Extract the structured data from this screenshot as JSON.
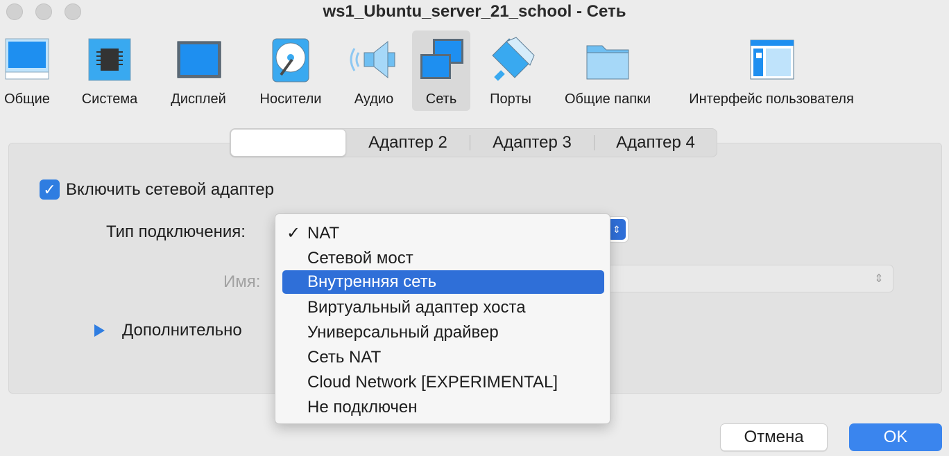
{
  "window": {
    "title": "ws1_Ubuntu_server_21_school - Сеть"
  },
  "toolbar": {
    "items": [
      {
        "label": "Общие",
        "icon": "general-monitor-icon"
      },
      {
        "label": "Система",
        "icon": "chip-icon"
      },
      {
        "label": "Дисплей",
        "icon": "display-icon"
      },
      {
        "label": "Носители",
        "icon": "storage-disk-icon"
      },
      {
        "label": "Аудио",
        "icon": "speaker-icon"
      },
      {
        "label": "Сеть",
        "icon": "network-icon"
      },
      {
        "label": "Порты",
        "icon": "ports-plug-icon"
      },
      {
        "label": "Общие папки",
        "icon": "folder-icon"
      },
      {
        "label": "Интерфейс пользователя",
        "icon": "ui-window-icon"
      }
    ],
    "active": "Сеть"
  },
  "tabs": [
    {
      "label": ""
    },
    {
      "label": "Адаптер 2"
    },
    {
      "label": "Адаптер 3"
    },
    {
      "label": "Адаптер 4"
    }
  ],
  "adapter": {
    "enable_label": "Включить сетевой адаптер",
    "enabled": true,
    "attach_label": "Тип подключения:",
    "name_label": "Имя:",
    "advanced_label": "Дополнительно"
  },
  "dropdown": {
    "options": [
      "NAT",
      "Сетевой мост",
      "Внутренняя сеть",
      "Виртуальный адаптер хоста",
      "Универсальный драйвер",
      "Сеть NAT",
      "Cloud Network [EXPERIMENTAL]",
      "Не подключен"
    ],
    "checked": "NAT",
    "highlighted": "Внутренняя сеть"
  },
  "buttons": {
    "cancel": "Отмена",
    "ok": "OK"
  },
  "colors": {
    "accent": "#2f7de1",
    "highlight": "#2f6fd8",
    "ok_button": "#3a85ee"
  }
}
